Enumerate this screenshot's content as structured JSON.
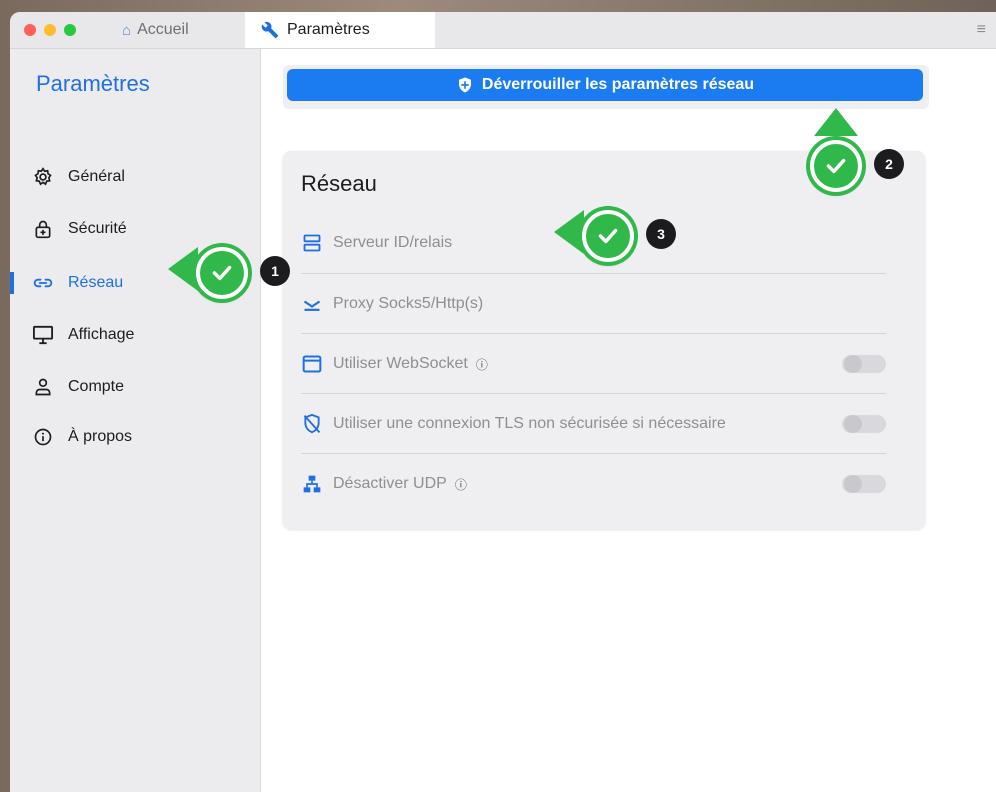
{
  "tabs": {
    "home_label": "Accueil",
    "settings_label": "Paramètres"
  },
  "sidebar": {
    "title": "Paramètres",
    "items": [
      {
        "label": "Général",
        "icon": "gear-icon"
      },
      {
        "label": "Sécurité",
        "icon": "lock-icon"
      },
      {
        "label": "Réseau",
        "icon": "link-icon",
        "active": true
      },
      {
        "label": "Affichage",
        "icon": "monitor-icon"
      },
      {
        "label": "Compte",
        "icon": "person-icon"
      },
      {
        "label": "À propos",
        "icon": "info-icon"
      }
    ]
  },
  "main": {
    "unlock_button": "Déverrouiller les paramètres réseau",
    "card": {
      "title": "Réseau",
      "rows": [
        {
          "label": "Serveur ID/relais",
          "icon": "server-icon"
        },
        {
          "label": "Proxy Socks5/Http(s)",
          "icon": "proxy-icon"
        },
        {
          "label": "Utiliser WebSocket",
          "icon": "window-icon",
          "help": "?",
          "toggle": false
        },
        {
          "label": "Utiliser une connexion TLS non sécurisée si nécessaire",
          "icon": "tls-icon",
          "toggle": false
        },
        {
          "label": "Désactiver UDP",
          "icon": "network-icon",
          "help": "?",
          "toggle": false
        }
      ]
    }
  },
  "markers": [
    {
      "number": "1"
    },
    {
      "number": "2"
    },
    {
      "number": "3"
    }
  ],
  "colors": {
    "accent": "#1f6fe0",
    "button": "#1b7cf2",
    "marker_green": "#31b84a"
  }
}
